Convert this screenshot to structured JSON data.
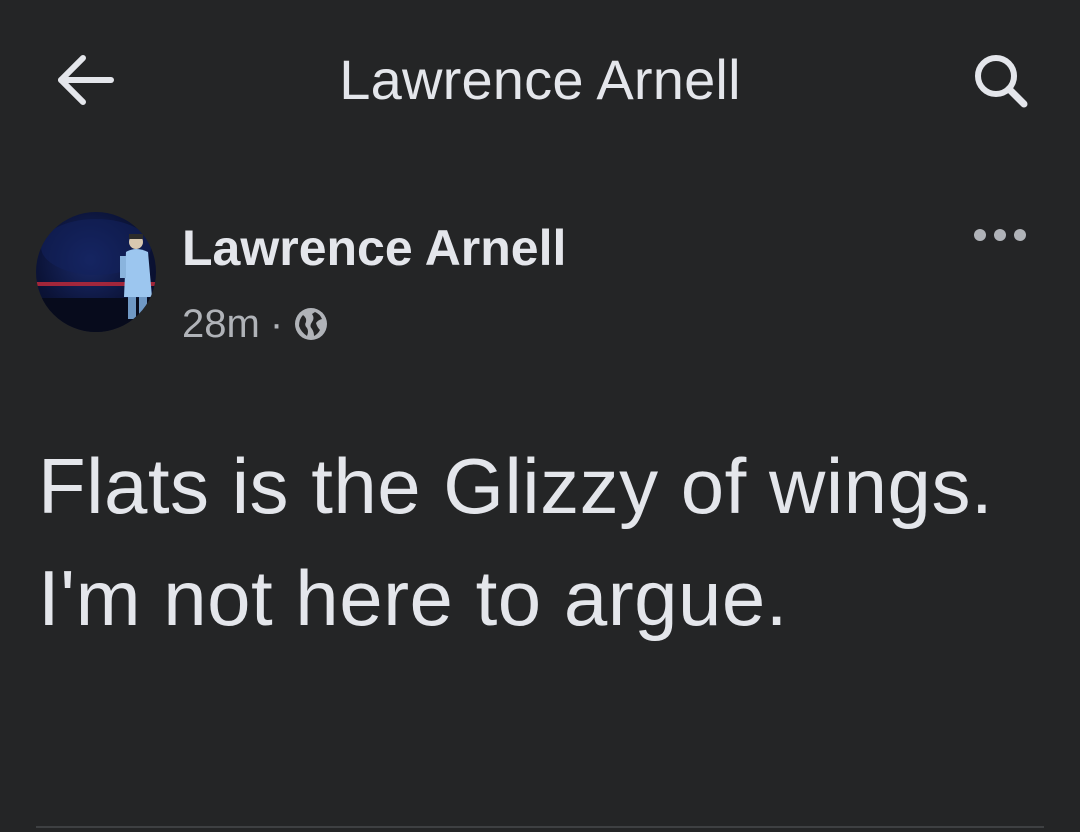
{
  "appbar": {
    "title": "Lawrence Arnell",
    "back_icon": "arrow-left-icon",
    "search_icon": "search-icon"
  },
  "post": {
    "author": "Lawrence Arnell",
    "time": "28m",
    "separator": "·",
    "privacy_icon": "globe-icon",
    "more_icon": "more-horizontal-icon",
    "text": "Flats is the Glizzy of wings. I'm not here to argue."
  },
  "colors": {
    "background": "#242526",
    "primary_text": "#e4e6eb",
    "secondary_text": "#b0b3b8"
  }
}
